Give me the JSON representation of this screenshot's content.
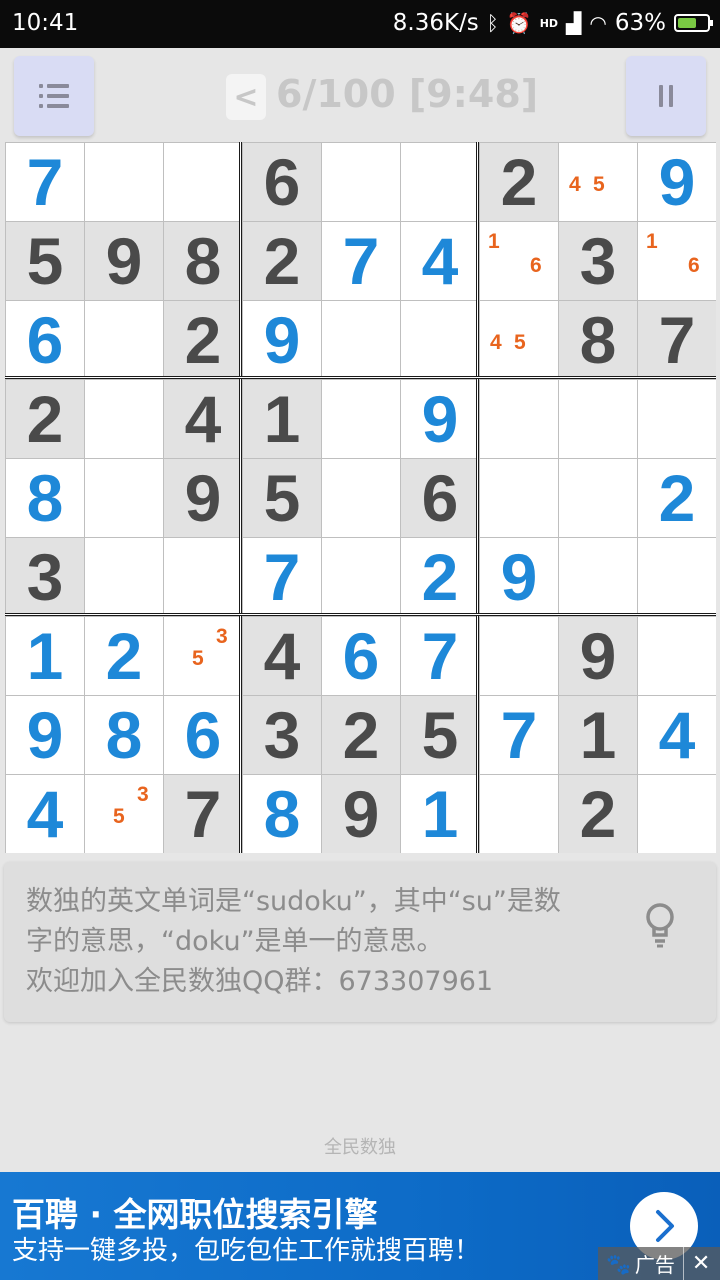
{
  "status_bar": {
    "time": "10:41",
    "speed": "8.36K/s",
    "network": "HD",
    "battery_percent": "63%",
    "battery_level": 0.63
  },
  "header": {
    "back_label": "<",
    "progress_text": "6/100 [9:48]"
  },
  "board": {
    "colors": {
      "given_text": "#4a4a4a",
      "user_text": "#1e88d8",
      "note_text": "#e8641e",
      "given_bg": "#e2e2e2"
    },
    "rows": [
      [
        {
          "v": "7",
          "t": "user"
        },
        {
          "v": "",
          "t": "empty"
        },
        {
          "v": "",
          "t": "empty"
        },
        {
          "v": "6",
          "t": "given"
        },
        {
          "v": "",
          "t": "empty"
        },
        {
          "v": "",
          "t": "empty"
        },
        {
          "v": "2",
          "t": "given"
        },
        {
          "v": "",
          "t": "notes",
          "notes": [
            "4",
            "5"
          ],
          "layout": "row"
        },
        {
          "v": "9",
          "t": "user"
        }
      ],
      [
        {
          "v": "5",
          "t": "given"
        },
        {
          "v": "9",
          "t": "given"
        },
        {
          "v": "8",
          "t": "given"
        },
        {
          "v": "2",
          "t": "given"
        },
        {
          "v": "7",
          "t": "user"
        },
        {
          "v": "4",
          "t": "user"
        },
        {
          "v": "",
          "t": "notes",
          "notes": [
            "1",
            "6"
          ],
          "layout": "diag"
        },
        {
          "v": "3",
          "t": "given"
        },
        {
          "v": "",
          "t": "notes",
          "notes": [
            "1",
            "6"
          ],
          "layout": "diag"
        }
      ],
      [
        {
          "v": "6",
          "t": "user"
        },
        {
          "v": "",
          "t": "empty"
        },
        {
          "v": "2",
          "t": "given"
        },
        {
          "v": "9",
          "t": "user"
        },
        {
          "v": "",
          "t": "empty"
        },
        {
          "v": "",
          "t": "empty"
        },
        {
          "v": "",
          "t": "notes",
          "notes": [
            "4",
            "5"
          ],
          "layout": "row"
        },
        {
          "v": "8",
          "t": "given"
        },
        {
          "v": "7",
          "t": "given"
        }
      ],
      [
        {
          "v": "2",
          "t": "given"
        },
        {
          "v": "",
          "t": "empty"
        },
        {
          "v": "4",
          "t": "given"
        },
        {
          "v": "1",
          "t": "given"
        },
        {
          "v": "",
          "t": "empty"
        },
        {
          "v": "9",
          "t": "user"
        },
        {
          "v": "",
          "t": "empty"
        },
        {
          "v": "",
          "t": "empty"
        },
        {
          "v": "",
          "t": "empty"
        }
      ],
      [
        {
          "v": "8",
          "t": "user"
        },
        {
          "v": "",
          "t": "empty"
        },
        {
          "v": "9",
          "t": "given"
        },
        {
          "v": "5",
          "t": "given"
        },
        {
          "v": "",
          "t": "empty"
        },
        {
          "v": "6",
          "t": "given"
        },
        {
          "v": "",
          "t": "empty"
        },
        {
          "v": "",
          "t": "empty"
        },
        {
          "v": "2",
          "t": "user"
        }
      ],
      [
        {
          "v": "3",
          "t": "given"
        },
        {
          "v": "",
          "t": "empty"
        },
        {
          "v": "",
          "t": "empty"
        },
        {
          "v": "7",
          "t": "user"
        },
        {
          "v": "",
          "t": "empty"
        },
        {
          "v": "2",
          "t": "user"
        },
        {
          "v": "9",
          "t": "user"
        },
        {
          "v": "",
          "t": "empty"
        },
        {
          "v": "",
          "t": "empty"
        }
      ],
      [
        {
          "v": "1",
          "t": "user"
        },
        {
          "v": "2",
          "t": "user"
        },
        {
          "v": "",
          "t": "notes",
          "notes": [
            "3",
            "5"
          ],
          "layout": "antidiag"
        },
        {
          "v": "4",
          "t": "given"
        },
        {
          "v": "6",
          "t": "user"
        },
        {
          "v": "7",
          "t": "user"
        },
        {
          "v": "",
          "t": "empty"
        },
        {
          "v": "9",
          "t": "given"
        },
        {
          "v": "",
          "t": "empty"
        }
      ],
      [
        {
          "v": "9",
          "t": "user"
        },
        {
          "v": "8",
          "t": "user"
        },
        {
          "v": "6",
          "t": "user"
        },
        {
          "v": "3",
          "t": "given"
        },
        {
          "v": "2",
          "t": "given"
        },
        {
          "v": "5",
          "t": "given"
        },
        {
          "v": "7",
          "t": "user"
        },
        {
          "v": "1",
          "t": "given"
        },
        {
          "v": "4",
          "t": "user"
        }
      ],
      [
        {
          "v": "4",
          "t": "user"
        },
        {
          "v": "",
          "t": "notes",
          "notes": [
            "3",
            "5"
          ],
          "layout": "antidiag"
        },
        {
          "v": "7",
          "t": "given"
        },
        {
          "v": "8",
          "t": "user"
        },
        {
          "v": "9",
          "t": "given"
        },
        {
          "v": "1",
          "t": "user"
        },
        {
          "v": "",
          "t": "empty"
        },
        {
          "v": "2",
          "t": "given"
        },
        {
          "v": "",
          "t": "empty"
        }
      ]
    ]
  },
  "tip": {
    "lines": [
      "数独的英文单词是“sudoku”，其中“su”是数",
      "字的意思，“doku”是单一的意思。",
      "欢迎加入全民数独QQ群：673307961"
    ]
  },
  "footer_label": "全民数独",
  "ad": {
    "title": "百聘 · 全网职位搜索引擎",
    "subtitle": "支持一键多投，包吃包住工作就搜百聘！",
    "badge_label": "广告",
    "close_label": "✕"
  }
}
